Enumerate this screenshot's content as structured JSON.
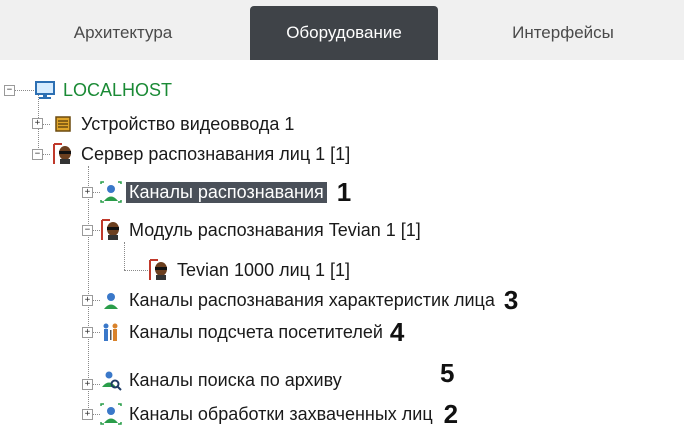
{
  "tabs": [
    {
      "label": "Архитектура",
      "active": false
    },
    {
      "label": "Оборудование",
      "active": true
    },
    {
      "label": "Интерфейсы",
      "active": false
    }
  ],
  "tree": {
    "root": {
      "label": "LOCALHOST",
      "icon": "monitor-icon",
      "color": "#1a8a35"
    },
    "video_device": {
      "label": "Устройство видеоввода 1",
      "icon": "chip-icon"
    },
    "face_server": {
      "label": "Сервер распознавания лиц 1 [1]",
      "icon": "face-server-icon"
    },
    "recognition_channels": {
      "label": "Каналы распознавания",
      "icon": "person-icon",
      "marker": "1",
      "selected": true
    },
    "tevian_module": {
      "label": "Модуль распознавания Tevian 1 [1]",
      "icon": "face-server-icon"
    },
    "tevian_db": {
      "label": "Tevian 1000 лиц 1 [1]",
      "icon": "face-server-icon"
    },
    "attribute_channels": {
      "label": "Каналы распознавания характеристик лица",
      "icon": "person-icon",
      "marker": "3"
    },
    "counting_channels": {
      "label": "Каналы подсчета посетителей",
      "icon": "people-icon",
      "marker": "4"
    },
    "archive_search_channels": {
      "label": "Каналы поиска по архиву",
      "icon": "person-search-icon",
      "marker": "5"
    },
    "captured_channels": {
      "label": "Каналы обработки захваченных лиц",
      "icon": "person-frame-icon",
      "marker": "2"
    }
  }
}
